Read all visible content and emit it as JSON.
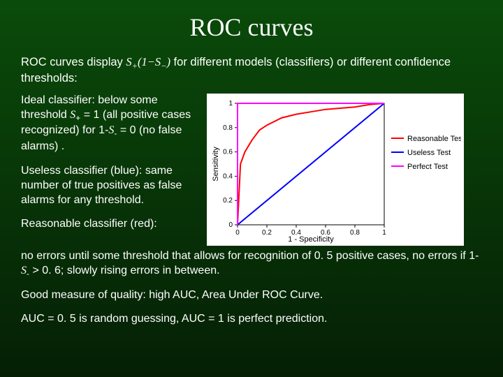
{
  "title": "ROC curves",
  "intro_a": "ROC curves display ",
  "intro_formula": "S",
  "intro_b": " for different models (classifiers) or different confidence thresholds:",
  "para_ideal_a": "Ideal classifier: below some threshold ",
  "para_ideal_b": " = 1 (all positive cases recognized) for 1-",
  "para_ideal_c": " = 0 (no false alarms) .",
  "para_useless": "Useless classifier (blue): same number of true positives as false alarms for any threshold.",
  "para_reasonable_head": "Reasonable classifier (red):",
  "para_reasonable_body_a": "no errors until some threshold that allows for recognition of 0. 5 positive cases, no errors if 1-",
  "para_reasonable_body_b": " > 0. 6; slowly rising errors in between.",
  "para_auc1": "Good measure of quality: high AUC, Area Under ROC Curve.",
  "para_auc2": "AUC = 0. 5 is random guessing, AUC = 1 is perfect prediction.",
  "chart_data": {
    "type": "line",
    "xlabel": "1 - Specificity",
    "ylabel": "Sensitivity",
    "xlim": [
      0,
      1
    ],
    "ylim": [
      0,
      1
    ],
    "xticks": [
      0,
      0.2,
      0.4,
      0.6,
      0.8,
      1.0
    ],
    "yticks": [
      0,
      0.2,
      0.4,
      0.6,
      0.8,
      1.0
    ],
    "series": [
      {
        "name": "Reasonable Test",
        "color": "#ff0000",
        "x": [
          0,
          0.02,
          0.05,
          0.1,
          0.15,
          0.2,
          0.3,
          0.4,
          0.5,
          0.6,
          0.7,
          0.8,
          0.9,
          1.0
        ],
        "y": [
          0,
          0.5,
          0.6,
          0.7,
          0.78,
          0.82,
          0.88,
          0.91,
          0.93,
          0.95,
          0.96,
          0.97,
          0.99,
          1.0
        ]
      },
      {
        "name": "Useless Test",
        "color": "#0000ff",
        "x": [
          0,
          1
        ],
        "y": [
          0,
          1
        ]
      },
      {
        "name": "Perfect Test",
        "color": "#ff00ff",
        "x": [
          0,
          0,
          1
        ],
        "y": [
          0,
          1,
          1
        ]
      }
    ],
    "legend": [
      "Reasonable Test",
      "Useless Test",
      "Perfect Test"
    ]
  }
}
